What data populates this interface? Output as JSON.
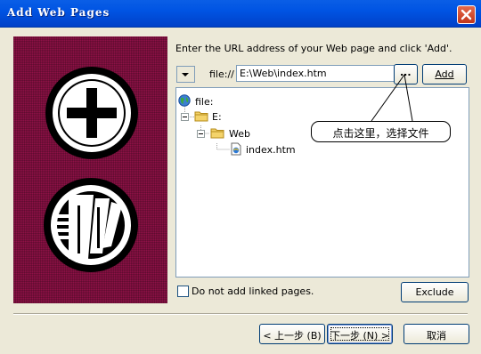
{
  "window": {
    "title": "Add Web Pages",
    "close_glyph": "✕"
  },
  "side_panel": {
    "icons": [
      "plus-circle-icon",
      "web-pages-stack-icon"
    ]
  },
  "url_bar": {
    "instruction": "Enter the URL address of your Web page and click 'Add'.",
    "scheme": "file://",
    "value": "E:\\Web\\index.htm",
    "browse_label": "...",
    "add_label": "Add"
  },
  "tree": {
    "root": {
      "label": "file:",
      "icon": "globe-icon"
    },
    "drive": {
      "label": "E:",
      "icon": "folder-icon"
    },
    "folder": {
      "label": "Web",
      "icon": "folder-icon"
    },
    "file": {
      "label": "index.htm",
      "icon": "html-file-icon"
    }
  },
  "callout": {
    "text": "点击这里，选择文件"
  },
  "options": {
    "no_linked_label": "Do not add linked pages.",
    "no_linked_checked": false,
    "exclude_label": "Exclude"
  },
  "nav": {
    "back_label": "< 上一步 (B)",
    "next_label": "下一步 (N) >",
    "cancel_label": "取消"
  }
}
